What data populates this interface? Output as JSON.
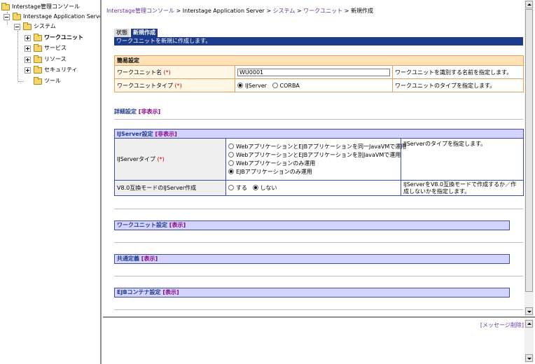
{
  "tree": {
    "root": "Interstage管理コンソール",
    "server": "Interstage Application Server",
    "system": "システム",
    "items": [
      {
        "label": "ワークユニット",
        "bold": true
      },
      {
        "label": "サービス"
      },
      {
        "label": "リソース"
      },
      {
        "label": "セキュリティ"
      },
      {
        "label": "ツール"
      }
    ]
  },
  "breadcrumb": {
    "console": "Interstage管理コンソール",
    "sep": " > ",
    "server": "Interstage Application Server",
    "system": "システム",
    "workunit": "ワークユニット",
    "current": "新規作成"
  },
  "tabs": {
    "status": "状態",
    "create": "新規作成"
  },
  "tab_message": "ワークユニットを新規に作成します。",
  "simple_settings": {
    "title": "簡易設定",
    "required_mark": "(*)",
    "name_label": "ワークユニット名",
    "name_value": "WU0001",
    "name_desc": "ワークユニットを識別する名前を指定します。",
    "type_label": "ワークユニットタイプ",
    "type_options": [
      "IJServer",
      "CORBA"
    ],
    "type_selected": 0,
    "type_desc": "ワークユニットのタイプを指定します。"
  },
  "detail_settings": {
    "label": "詳細設定",
    "toggle": "[非表示]"
  },
  "ijserver": {
    "title": "IJServer設定",
    "toggle": "[非表示]",
    "type_label": "IJServerタイプ",
    "required_mark": "(*)",
    "type_options": [
      "WebアプリケーションとEJBアプリケーションを同一JavaVMで運用",
      "WebアプリケーションとEJBアプリケーションを別JavaVMで運用",
      "Webアプリケーションのみ運用",
      "EJBアプリケーションのみ運用"
    ],
    "type_selected": 3,
    "type_desc": "IJServerのタイプを指定します。",
    "compat_label": "V8.0互換モードのIJServer作成",
    "compat_options": [
      "する",
      "しない"
    ],
    "compat_selected": 1,
    "compat_desc": "IJServerをV8.0互換モードで作成するか／作成しないかを指定します。"
  },
  "collapsed_sections": [
    {
      "label": "ワークユニット設定",
      "toggle": "[表示]"
    },
    {
      "label": "共通定義",
      "toggle": "[表示]"
    },
    {
      "label": "EJBコンテナ設定",
      "toggle": "[表示]"
    }
  ],
  "message_pane": {
    "clear_link": "[メッセージ削除]"
  },
  "icons": [
    "folder-icon",
    "expand-plus-icon",
    "collapse-minus-icon",
    "radio-icon",
    "scroll-up-arrow-icon",
    "scroll-down-arrow-icon"
  ]
}
